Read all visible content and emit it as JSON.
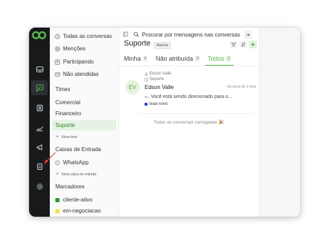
{
  "sidebar": {
    "nav": [
      {
        "label": "Todas as conversas",
        "icon": "inbox-icon"
      },
      {
        "label": "Menções",
        "icon": "at-icon"
      },
      {
        "label": "Participando",
        "icon": "user-icon"
      },
      {
        "label": "Não atendidas",
        "icon": "mail-icon"
      }
    ],
    "teams_header": "Times",
    "teams": [
      "Comercial",
      "Financeiro",
      "Suporte"
    ],
    "new_team": "Novo time",
    "inboxes_header": "Caixas de Entrada",
    "inboxes": [
      {
        "label": "WhatsApp",
        "icon": "whatsapp-icon"
      }
    ],
    "new_inbox": "Nova caixa de entrada",
    "labels_header": "Marcadores",
    "labels": [
      {
        "label": "cliente-ativo",
        "color": "#2a9d2a"
      },
      {
        "label": "em-negociacao",
        "color": "#f0e04b"
      }
    ]
  },
  "main": {
    "search_placeholder": "Procurar por mensagens nas conversas",
    "title": "Suporte",
    "status_badge": "Abertas",
    "tabs": [
      {
        "label": "Minha",
        "count": "0"
      },
      {
        "label": "Não atribuída",
        "count": "0"
      },
      {
        "label": "Todos",
        "count": "1"
      }
    ],
    "conversation": {
      "avatar_initials": "EV",
      "contact_line": "Edson Valle",
      "inbox_line": "Suporte",
      "name": "Edson Valle",
      "time": "há cerca de 1 hora",
      "message": "Você está sendo direcionado para o...",
      "label": "lead-novo"
    },
    "all_loaded": "Todas as conversas carregadas 🎉"
  },
  "colors": {
    "rail_bg": "#17191b",
    "accent": "#58b24c",
    "active_sidebar_bg": "#e6f3e4"
  }
}
